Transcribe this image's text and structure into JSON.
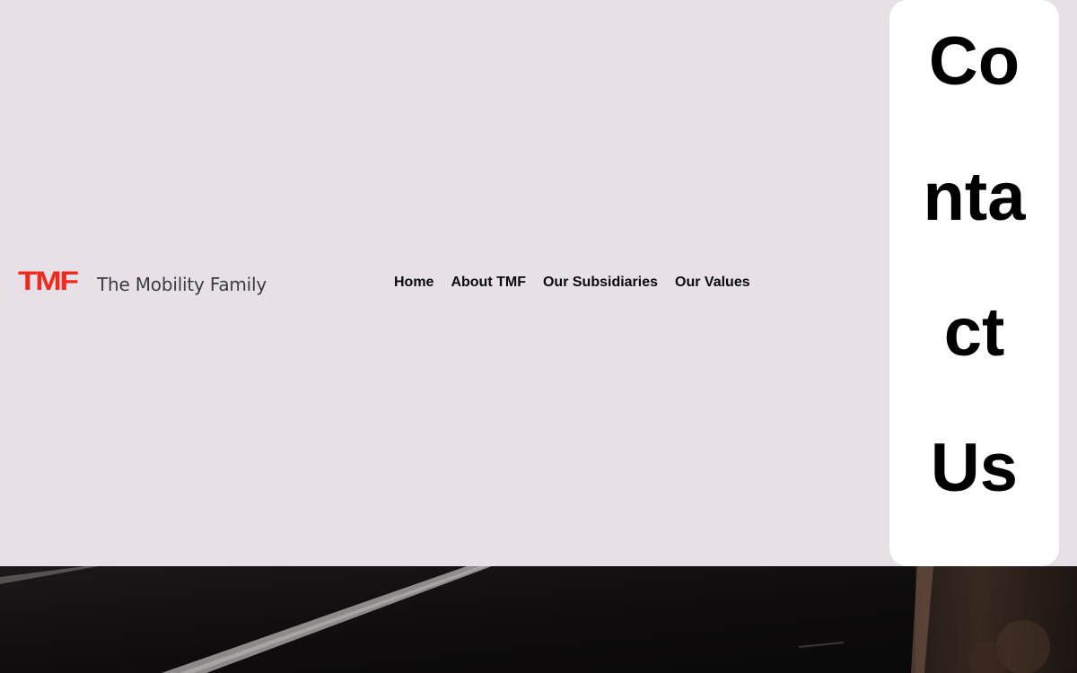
{
  "brand": {
    "mark": "TMF",
    "name": "The Mobility Family",
    "accent_color": "#ef2a1c"
  },
  "nav": {
    "items": [
      {
        "label": "Home"
      },
      {
        "label": "About TMF"
      },
      {
        "label": "Our Subsidiaries"
      },
      {
        "label": "Our Values"
      }
    ]
  },
  "contact": {
    "label": "Contact Us"
  },
  "colors": {
    "header_background": "#e7e1e7",
    "contact_background": "#ffffff",
    "hero_background": "#0f0d0d"
  }
}
